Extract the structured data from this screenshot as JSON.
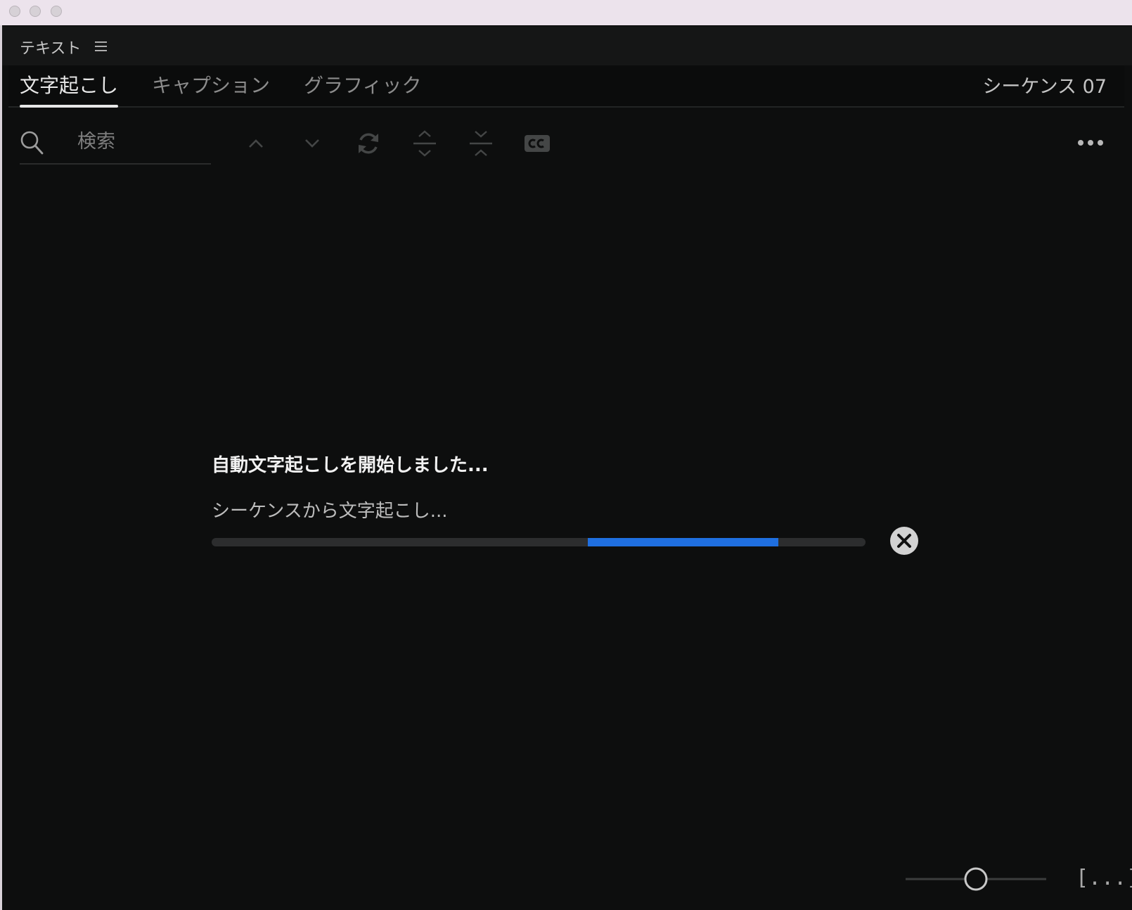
{
  "panel": {
    "title": "テキスト",
    "menu_icon": "hamburger-menu-icon"
  },
  "tabs": [
    {
      "label": "文字起こし",
      "active": true
    },
    {
      "label": "キャプション",
      "active": false
    },
    {
      "label": "グラフィック",
      "active": false
    }
  ],
  "sequence": {
    "label": "シーケンス 07"
  },
  "search": {
    "placeholder": "検索",
    "value": ""
  },
  "toolbar": {
    "icons": [
      "chevron-up-icon",
      "chevron-down-icon",
      "refresh-icon",
      "expand-vertical-icon",
      "collapse-vertical-icon",
      "closed-caption-icon",
      "more-options-icon"
    ],
    "enabled": false
  },
  "status": {
    "title": "自動文字起こしを開始しました...",
    "subtitle": "シーケンスから文字起こし...",
    "progress_start": 0.575,
    "progress_end": 0.867
  },
  "footer": {
    "zoom_level": 0.5,
    "bracket_label": "[...]"
  },
  "colors": {
    "background": "#0d0e0e",
    "accent": "#1f6fe0",
    "titlebar": "#ece3ec"
  }
}
